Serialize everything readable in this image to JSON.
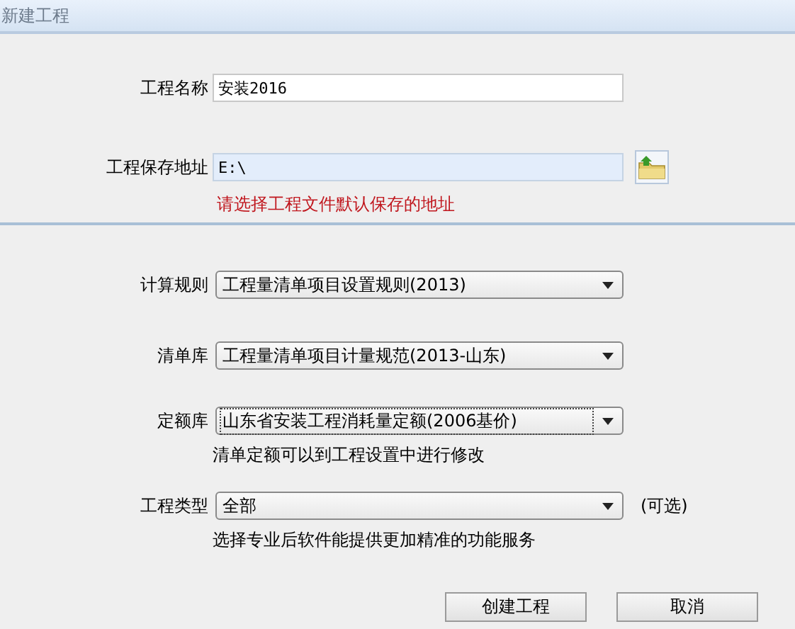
{
  "window": {
    "title": "新建工程"
  },
  "project_name": {
    "label": "工程名称",
    "value": "安装2016"
  },
  "save_path": {
    "label": "工程保存地址",
    "value": "E:\\",
    "hint": "请选择工程文件默认保存的地址"
  },
  "selects": [
    {
      "label": "计算规则",
      "value": "工程量清单项目设置规则(2013)",
      "focused": false
    },
    {
      "label": "清单库",
      "value": "工程量清单项目计量规范(2013-山东)",
      "focused": false
    },
    {
      "label": "定额库",
      "value": "山东省安装工程消耗量定额(2006基价)",
      "focused": true,
      "note": "清单定额可以到工程设置中进行修改"
    },
    {
      "label": "工程类型",
      "value": "全部",
      "focused": false,
      "suffix": "(可选)",
      "note": "选择专业后软件能提供更加精准的功能服务"
    }
  ],
  "buttons": [
    "创建工程",
    "取消"
  ]
}
